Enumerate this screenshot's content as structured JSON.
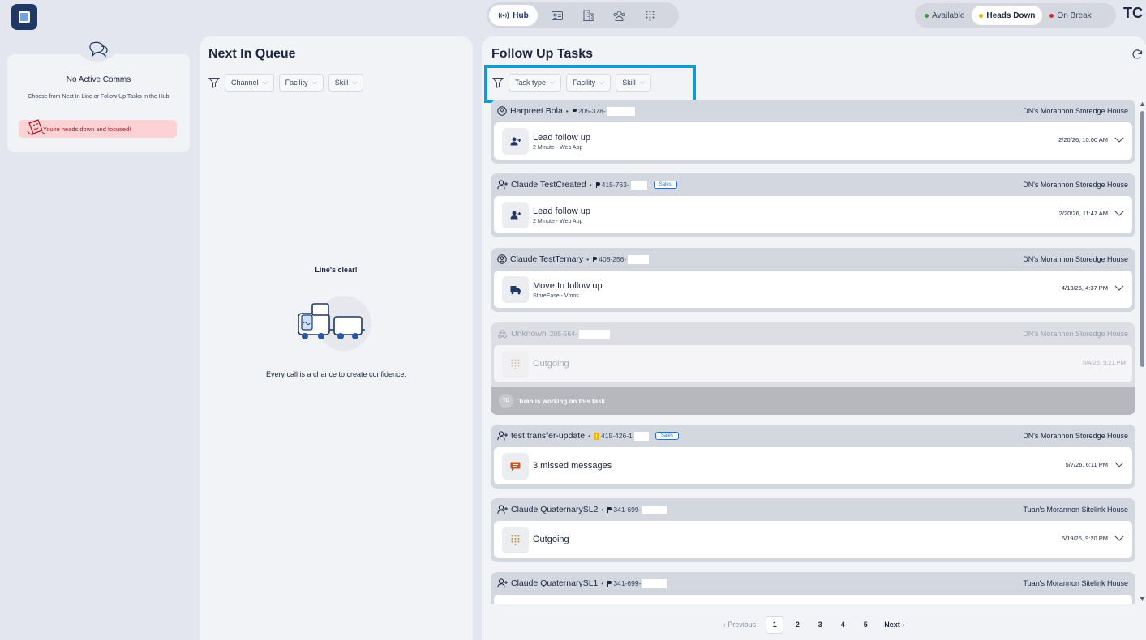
{
  "app": {
    "avatar_initials": "TC"
  },
  "nav": {
    "hub_label": "Hub",
    "items": [
      "id-card-icon",
      "building-icon",
      "team-icon",
      "dialpad-icon"
    ]
  },
  "status": {
    "items": [
      {
        "label": "Available",
        "color": "#2e9e4f"
      },
      {
        "label": "Heads Down",
        "color": "#f2b100"
      },
      {
        "label": "On Break",
        "color": "#d9283a"
      }
    ],
    "selected": "Heads Down"
  },
  "comms": {
    "title": "No Active Comms",
    "subtitle": "Choose from Next In Line or Follow Up Tasks in the Hub",
    "heads_down_message": "You're heads down and focused!"
  },
  "queue": {
    "title": "Next In Queue",
    "filters": [
      "Channel",
      "Facility",
      "Skill"
    ],
    "empty_title": "Line's clear!",
    "empty_message": "Every call is a chance to create confidence."
  },
  "tasks": {
    "title": "Follow Up Tasks",
    "filters": [
      "Task type",
      "Facility",
      "Skill"
    ],
    "items": [
      {
        "contact": "Harpreet Bola",
        "phone": "205-378-",
        "badge": "",
        "facility": "DN's Morannon Storedge House",
        "task": "Lead follow up",
        "sub": "2 Minute - Web App",
        "date": "2/20/26, 10:00 AM",
        "icon": "user-add-icon"
      },
      {
        "contact": "Claude TestCreated",
        "phone": "415-763-",
        "badge": "Sales",
        "facility": "DN's Morannon Storedge House",
        "task": "Lead follow up",
        "sub": "2 Minute - Web App",
        "date": "2/20/26, 11:47 AM",
        "icon": "user-add-icon"
      },
      {
        "contact": "Claude TestTernary",
        "phone": "408-256-",
        "badge": "",
        "facility": "DN's Morannon Storedge House",
        "task": "Move In follow up",
        "sub": "StoreEase - Vmos",
        "date": "4/13/26, 4:37 PM",
        "icon": "move-in-icon"
      },
      {
        "contact": "Unknown",
        "phone": "205-564-",
        "badge": "",
        "facility": "DN's Morannon Storedge House",
        "task": "Outgoing",
        "sub": "",
        "date": "5/4/26, 5:21 PM",
        "icon": "dialpad-icon",
        "working_text": "Tuan is working on this task",
        "working_initials": "TD"
      },
      {
        "contact": "test transfer-update",
        "phone": "415-426-1",
        "badge": "Sales",
        "facility": "DN's Morannon Storedge House",
        "task": "3 missed messages",
        "sub": "",
        "date": "5/7/26, 6:11 PM",
        "icon": "message-icon"
      },
      {
        "contact": "Claude QuaternarySL2",
        "phone": "341-699-",
        "badge": "",
        "facility": "Tuan's Morannon Sitelink House",
        "task": "Outgoing",
        "sub": "",
        "date": "5/19/26, 9:20 PM",
        "icon": "dialpad-icon"
      },
      {
        "contact": "Claude QuaternarySL1",
        "phone": "341-699-",
        "badge": "",
        "facility": "Tuan's Morannon Sitelink House",
        "task": "",
        "sub": "",
        "date": "",
        "icon": ""
      }
    ]
  },
  "pagination": {
    "previous": "‹ Previous",
    "pages": [
      "1",
      "2",
      "3",
      "4",
      "5"
    ],
    "current": "1",
    "next": "Next ›"
  }
}
